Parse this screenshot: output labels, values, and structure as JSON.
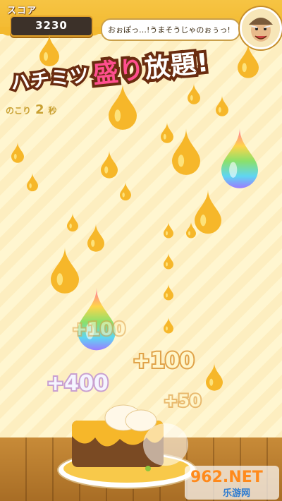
{
  "hud": {
    "score_label": "スコア",
    "score_value": "3230",
    "timer_prefix": "のこり",
    "timer_value": "2",
    "timer_unit": "秒"
  },
  "speech": {
    "text": "おぉぽっ…!うまそうじゃのぉぅっ!"
  },
  "banner": {
    "part1": "ハチミツ",
    "part2_pink": "盛り",
    "part2_white": "放題!"
  },
  "score_popups": [
    "+400",
    "+100",
    "+100",
    "+50"
  ],
  "colors": {
    "honey": "#f6b72a",
    "honey_light": "#fde27a",
    "outline": "#6a2c10",
    "pink_accent": "#ff4f8f"
  },
  "watermark": {
    "main": "962.NET",
    "sub": "乐游网"
  }
}
